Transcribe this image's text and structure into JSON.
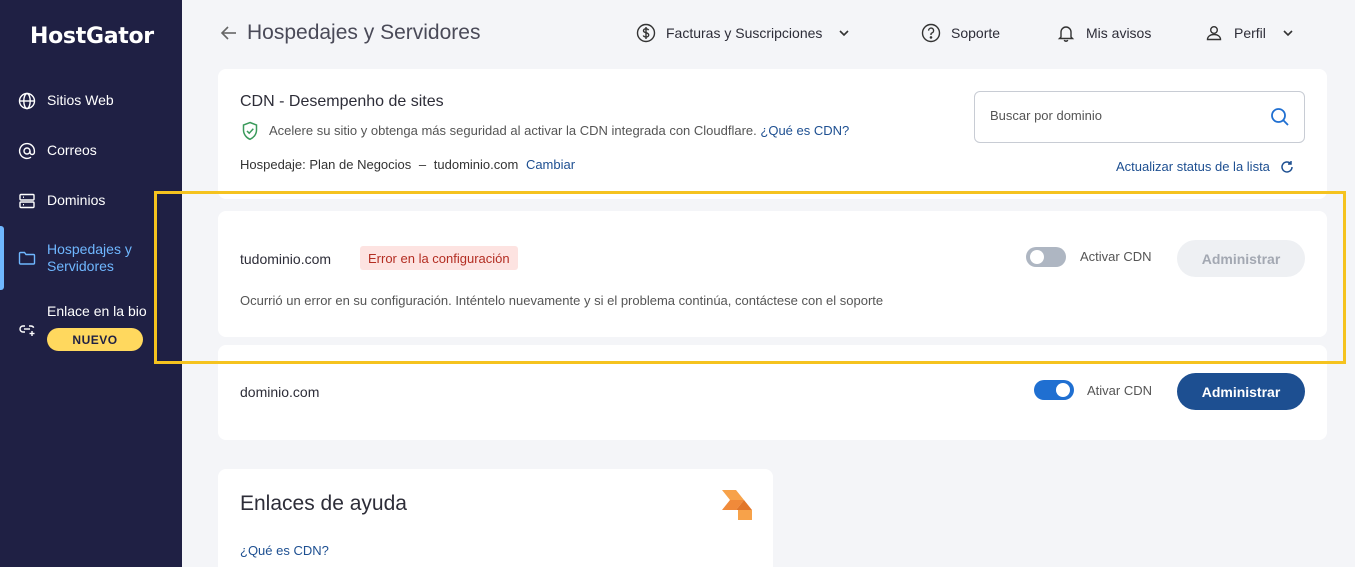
{
  "brand": {
    "name": "HostGator"
  },
  "sidebar": {
    "items": [
      {
        "label": "Sitios Web",
        "icon": "globe-icon"
      },
      {
        "label": "Correos",
        "icon": "at-icon"
      },
      {
        "label": "Dominios",
        "icon": "server-icon"
      },
      {
        "label": "Hospedajes y Servidores",
        "icon": "folder-icon",
        "active": true
      },
      {
        "label": "Enlace en la bio",
        "icon": "link-icon",
        "badge": "NUEVO"
      }
    ]
  },
  "header": {
    "title": "Hospedajes y Servidores",
    "billing": "Facturas y Suscripciones",
    "support": "Soporte",
    "notices": "Mis avisos",
    "profile": "Perfil"
  },
  "cdn": {
    "title": "CDN - Desempenho de sites",
    "description": "Acelere su sitio y obtenga más seguridad al activar la CDN integrada con Cloudflare.",
    "what_is_cdn": "¿Qué es CDN?",
    "hosting_label": "Hospedaje: Plan de Negocios",
    "hosting_sep": "–",
    "hosting_domain": "tudominio.com",
    "change": "Cambiar",
    "search_placeholder": "Buscar por dominio",
    "refresh": "Actualizar status de la lista"
  },
  "domains": [
    {
      "name": "tudominio.com",
      "status": "Error en la configuración",
      "error_message": "Ocurrió un error en su configuración. Inténtelo nuevamente y si el problema continúa, contáctese con el soporte",
      "toggle_label": "Activar CDN",
      "toggle_on": false,
      "button": "Administrar",
      "button_enabled": false
    },
    {
      "name": "dominio.com",
      "toggle_label": "Ativar CDN",
      "toggle_on": true,
      "button": "Administrar",
      "button_enabled": true
    }
  ],
  "help": {
    "title": "Enlaces de ayuda",
    "links": [
      "¿Qué es CDN?"
    ]
  },
  "colors": {
    "sidebar_bg": "#1f2044",
    "active": "#6fb7ff",
    "primary": "#1d4f91",
    "badge": "#ffd85e",
    "error_bg": "#fde3e1",
    "error_text": "#b32d22",
    "highlight": "#f5c31f",
    "toggle_on": "#1f6fd1"
  }
}
